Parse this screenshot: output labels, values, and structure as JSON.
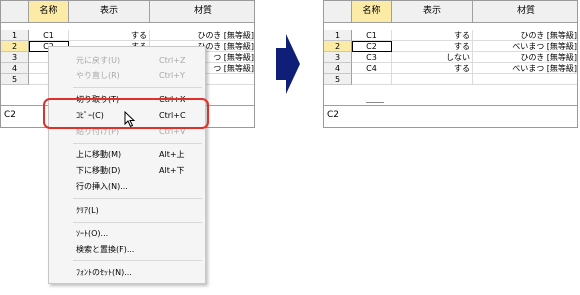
{
  "columns": {
    "name": "名称",
    "display": "表示",
    "material": "材質"
  },
  "left_table": {
    "row_numbers": [
      "1",
      "2",
      "3",
      "4",
      "5"
    ],
    "rows": [
      {
        "name": "C1",
        "display": "する",
        "material": "ひのき [無等級]"
      },
      {
        "name": "C2",
        "display": "する",
        "material": "ひのき [無等級]"
      },
      {
        "name": "",
        "display": "",
        "material": "つ [無等級]"
      },
      {
        "name": "",
        "display": "",
        "material": "つ [無等級]"
      },
      {
        "name": "",
        "display": "",
        "material": ""
      }
    ],
    "status_text": "C2"
  },
  "right_table": {
    "row_numbers": [
      "1",
      "2",
      "3",
      "4",
      "5"
    ],
    "rows": [
      {
        "name": "C1",
        "display": "する",
        "material": "ひのき [無等級]"
      },
      {
        "name": "C2",
        "display": "する",
        "material": "べいまつ [無等級]"
      },
      {
        "name": "C3",
        "display": "しない",
        "material": "ひのき [無等級]"
      },
      {
        "name": "C4",
        "display": "する",
        "material": "べいまつ [無等級]"
      },
      {
        "name": "",
        "display": "",
        "material": ""
      }
    ],
    "status_text": "C2"
  },
  "context_menu": {
    "undo": {
      "label": "元に戻す(U)",
      "shortcut": "Ctrl+Z"
    },
    "redo": {
      "label": "やり直し(R)",
      "shortcut": "Ctrl+Y"
    },
    "cut": {
      "label": "切り取り(T)",
      "shortcut": "Ctrl+X"
    },
    "copy": {
      "label": "ｺﾋﾟｰ(C)",
      "shortcut": "Ctrl+C"
    },
    "paste": {
      "label": "貼り付け(P)",
      "shortcut": "Ctrl+V"
    },
    "move_up": {
      "label": "上に移動(M)",
      "shortcut": "Alt+上"
    },
    "move_down": {
      "label": "下に移動(D)",
      "shortcut": "Alt+下"
    },
    "insert_row": {
      "label": "行の挿入(N)..."
    },
    "clear": {
      "label": "ｸﾘｱ(L)"
    },
    "sort": {
      "label": "ｿｰﾄ(O)..."
    },
    "find_replace": {
      "label": "検索と置換(F)..."
    },
    "font_set": {
      "label": "ﾌｫﾝﾄのｾｯﾄ(N)..."
    }
  },
  "colors": {
    "highlight": "#e0302a",
    "arrow": "#0f1f78",
    "selected_header": "#fbeba6"
  },
  "icons": {
    "arrow": "right-arrow-icon",
    "cursor": "mouse-pointer-icon"
  }
}
